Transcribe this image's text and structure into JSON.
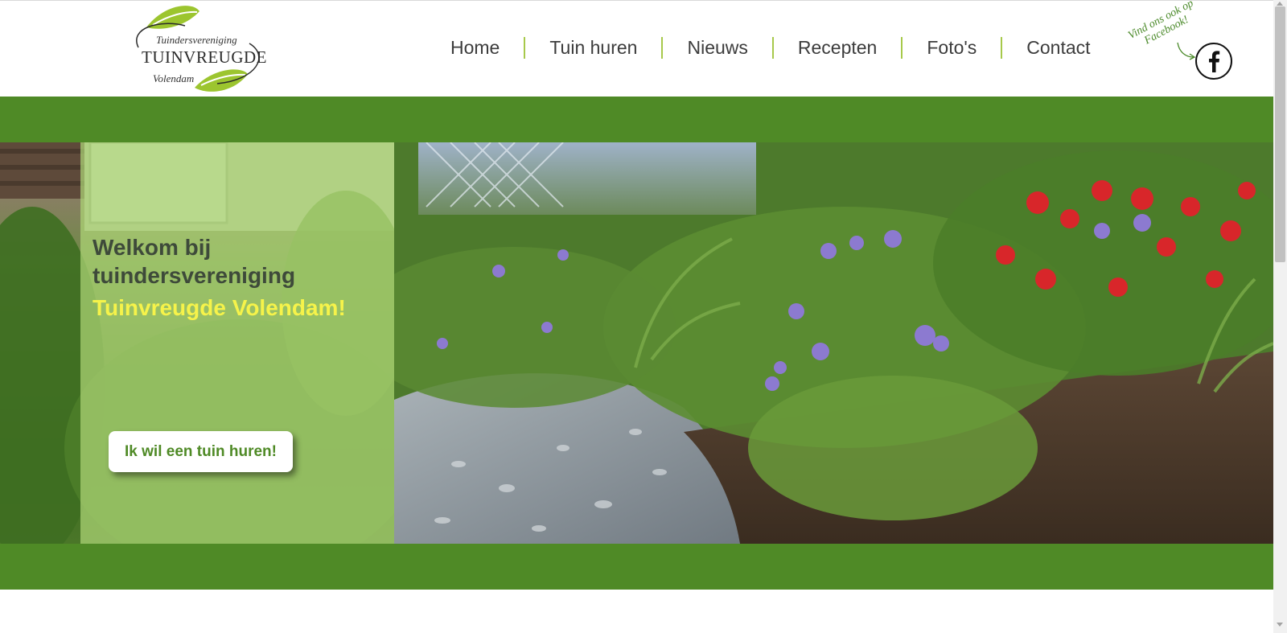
{
  "logo": {
    "line1": "Tuindersvereniging",
    "line2": "TUINVREUGDE",
    "line3": "Volendam"
  },
  "nav": {
    "items": [
      {
        "label": "Home"
      },
      {
        "label": "Tuin huren"
      },
      {
        "label": "Nieuws"
      },
      {
        "label": "Recepten"
      },
      {
        "label": "Foto's"
      },
      {
        "label": "Contact"
      }
    ]
  },
  "facebook": {
    "callout": "Vind ons ook op Facebook!",
    "icon": "facebook-icon"
  },
  "hero": {
    "title_line1": "Welkom bij tuindersvereniging",
    "title_line2": "Tuinvreugde Volendam!",
    "cta_label": "Ik wil een tuin huren!"
  },
  "colors": {
    "brand_green": "#4f8a26",
    "leaf_green": "#a7c94b",
    "overlay_green": "#add676",
    "highlight_yellow": "#f6f34a"
  }
}
